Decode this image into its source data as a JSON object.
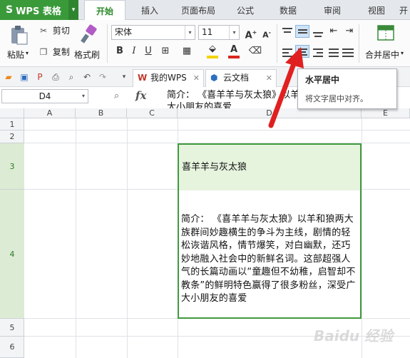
{
  "app": {
    "name": "WPS 表格",
    "menu_tabs": [
      "开始",
      "插入",
      "页面布局",
      "公式",
      "数据",
      "审阅",
      "视图",
      "开"
    ]
  },
  "ribbon": {
    "paste": "粘贴",
    "cut": "剪切",
    "copy": "复制",
    "format_painter": "格式刷",
    "font_name": "宋体",
    "font_size": "11",
    "merge_center": "合并居中",
    "font_color": "#d9261c",
    "fill_color": "#f5d200"
  },
  "doc_tabs": [
    {
      "label": "我的WPS",
      "icon": "wps-icon"
    },
    {
      "label": "云文档",
      "icon": "cloud-doc-icon"
    }
  ],
  "formula_bar": {
    "cell_ref": "D4",
    "fx": "fx",
    "content": "简介：  《喜羊羊与灰太狼》以羊和狼两大族群间妙趣横生的争斗为主线，剧情的轻松诙谐风格，情节爆笑，对白幽默，还巧妙地融入社会中的新鲜名词。这部超强人气的长篇动画以“童趣但不幼稚，启智却不教条”的鲜明特色赢得了很多粉丝，深受广大小朋友的喜爱",
    "content_line1": "简介：  《喜羊羊与灰太狼》以羊和狼两大族群间妙趣",
    "content_line2": "大小朋友的喜爱"
  },
  "tooltip": {
    "title": "水平居中",
    "description": "将文字居中对齐。"
  },
  "sheet": {
    "columns": [
      "A",
      "B",
      "C",
      "D",
      "E"
    ],
    "rows": [
      "1",
      "2",
      "3",
      "4",
      "5",
      "6"
    ],
    "cell_D3": "喜羊羊与灰太狼",
    "cell_D4": "简介：  《喜羊羊与灰太狼》以羊和狼两大族群间妙趣横生的争斗为主线，剧情的轻松诙谐风格，情节爆笑，对白幽默，还巧妙地融入社会中的新鲜名词。这部超强人气的长篇动画以“童趣但不幼稚，启智却不教条”的鲜明特色赢得了很多粉丝，深受广大小朋友的喜爱",
    "selection_color": "#3f9a3f",
    "selected_fill": "#e6f4de"
  },
  "watermark": "Baidu 经验"
}
